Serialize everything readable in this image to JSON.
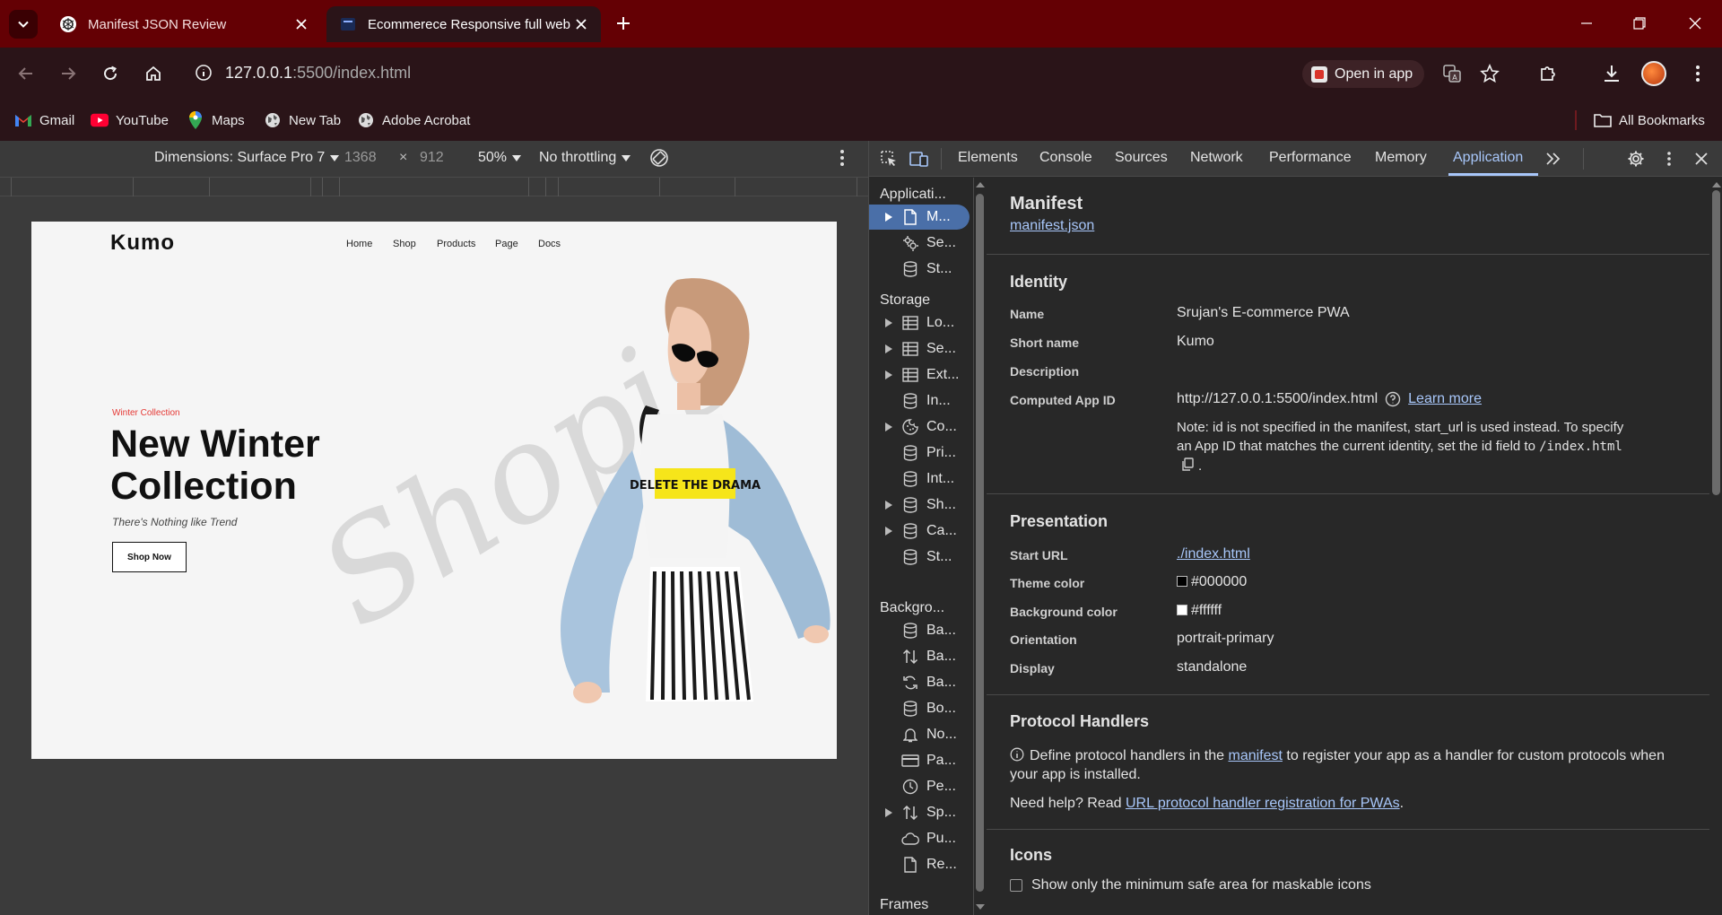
{
  "browser": {
    "tabs": [
      {
        "title": "Manifest JSON Review",
        "active": false
      },
      {
        "title": "Ecommerece Responsive full webit",
        "active": true
      }
    ],
    "url": {
      "host": "127.0.0.1",
      "path": ":5500/index.html"
    },
    "open_in_app": "Open in app",
    "bookmarks": [
      "Gmail",
      "YouTube",
      "Maps",
      "New Tab",
      "Adobe Acrobat"
    ],
    "all_bookmarks": "All Bookmarks"
  },
  "device_toolbar": {
    "dimensions": "Dimensions: Surface Pro 7",
    "width": "1368",
    "times": "×",
    "height": "912",
    "zoom": "50%",
    "throttling": "No throttling"
  },
  "site": {
    "logo": "Kumo",
    "nav": [
      "Home",
      "Shop",
      "Products",
      "Page",
      "Docs"
    ],
    "collection_label": "Winter Collection",
    "headline": "New Winter Collection",
    "tagline": "There's Nothing like Trend",
    "button": "Shop Now",
    "script_text": "Shopis",
    "shirt_text": "DELETE THE DRAMA"
  },
  "devtools": {
    "tabs": [
      "Elements",
      "Console",
      "Sources",
      "Network",
      "Performance",
      "Memory",
      "Application"
    ],
    "active_tab": "Application",
    "sidebar": {
      "app_header": "Applicati...",
      "app_items": [
        "M...",
        "Se...",
        "St..."
      ],
      "storage_header": "Storage",
      "storage_items": [
        "Lo...",
        "Se...",
        "Ext...",
        "In...",
        "Co...",
        "Pri...",
        "Int...",
        "Sh...",
        "Ca...",
        "St..."
      ],
      "background_header": "Backgro...",
      "background_items": [
        "Ba...",
        "Ba...",
        "Ba...",
        "Bo...",
        "No...",
        "Pa...",
        "Pe...",
        "Sp...",
        "Pu...",
        "Re..."
      ],
      "frames_header": "Frames"
    },
    "manifest": {
      "title": "Manifest",
      "file_link": "manifest.json",
      "identity_header": "Identity",
      "name_label": "Name",
      "name_value": "Srujan's E-commerce PWA",
      "short_name_label": "Short name",
      "short_name_value": "Kumo",
      "description_label": "Description",
      "computed_id_label": "Computed App ID",
      "computed_id_value": "http://127.0.0.1:5500/index.html",
      "learn_more": "Learn more",
      "note_text": "Note: id is not specified in the manifest, start_url is used instead. To specify an App ID that matches the current identity, set the id field to",
      "note_code": "/index.html",
      "presentation_header": "Presentation",
      "start_url_label": "Start URL",
      "start_url_value": "./index.html",
      "theme_color_label": "Theme color",
      "theme_color_value": "#000000",
      "bg_color_label": "Background color",
      "bg_color_value": "#ffffff",
      "orientation_label": "Orientation",
      "orientation_value": "portrait-primary",
      "display_label": "Display",
      "display_value": "standalone",
      "protocol_header": "Protocol Handlers",
      "protocol_text_1": "Define protocol handlers in the",
      "protocol_link": "manifest",
      "protocol_text_2": "to register your app as a handler for custom protocols when your app is installed.",
      "help_text": "Need help? Read",
      "help_link": "URL protocol handler registration for PWAs",
      "icons_header": "Icons",
      "maskable_label": "Show only the minimum safe area for maskable icons"
    }
  },
  "colors": {
    "frame": "#640004",
    "toolbar": "#2a1418",
    "accent": "#a8c7fa",
    "selection": "#4a6fa8"
  }
}
